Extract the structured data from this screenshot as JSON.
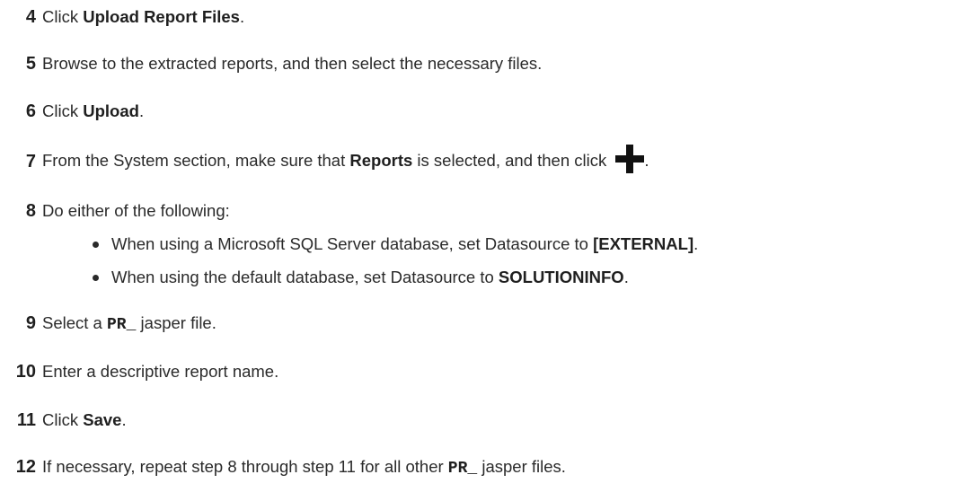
{
  "steps": [
    {
      "number": "4",
      "parts": [
        "Click ",
        "Upload Report Files",
        "."
      ]
    },
    {
      "number": "5",
      "parts": [
        "Browse to the extracted reports, and then select the necessary files."
      ]
    },
    {
      "number": "6",
      "parts": [
        "Click ",
        "Upload",
        "."
      ]
    },
    {
      "number": "7",
      "parts": [
        "From the System section, make sure that ",
        "Reports",
        " is selected, and then click ",
        "."
      ],
      "icon": "plus-icon"
    },
    {
      "number": "8",
      "parts": [
        "Do either of the following:"
      ],
      "bullets": [
        {
          "parts": [
            "When using a Microsoft SQL Server database, set Datasource to ",
            "[EXTERNAL]",
            "."
          ]
        },
        {
          "parts": [
            "When using the default database, set Datasource to ",
            "SOLUTIONINFO",
            "."
          ]
        }
      ]
    },
    {
      "number": "9",
      "parts": [
        "Select a ",
        "PR_",
        " jasper file."
      ]
    },
    {
      "number": "10",
      "parts": [
        "Enter a descriptive report name."
      ]
    },
    {
      "number": "11",
      "parts": [
        "Click ",
        "Save",
        "."
      ]
    },
    {
      "number": "12",
      "parts": [
        "If necessary, repeat step 8 through step 11 for all other ",
        "PR_",
        " jasper files."
      ]
    }
  ]
}
